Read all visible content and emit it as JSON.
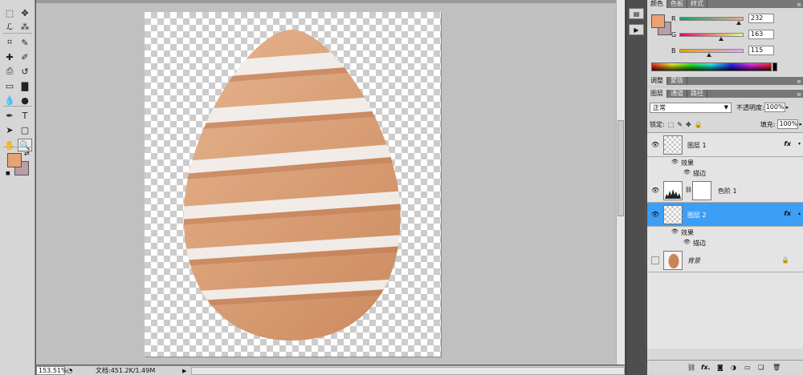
{
  "tools": {
    "icons": [
      "marquee-icon",
      "move-icon",
      "lasso-icon",
      "magic-wand-icon",
      "crop-icon",
      "eyedropper-icon",
      "healing-brush-icon",
      "brush-icon",
      "clone-stamp-icon",
      "history-brush-icon",
      "eraser-icon",
      "gradient-icon",
      "blur-icon",
      "dodge-icon",
      "pen-icon",
      "type-icon",
      "path-selection-icon",
      "shape-icon",
      "hand-icon",
      "zoom-icon"
    ],
    "glyphs": [
      "⬚",
      "✥",
      "ℒ",
      "⁂",
      "⌗",
      "✎",
      "✚",
      "✐",
      "⎙",
      "↺",
      "▭",
      "▇",
      "💧",
      "●",
      "✒",
      "T",
      "➤",
      "▢",
      "✋",
      "🔍"
    ],
    "foreground_color": "#e8a373",
    "background_color": "#b79ea7"
  },
  "canvas": {
    "egg_color": "#d99a73",
    "egg_light": "#e9b994",
    "egg_shadow": "#bf7a52"
  },
  "statusbar": {
    "zoom": "153.51%",
    "doc_info": "文档:451.2K/1.49M",
    "arrow": "▶"
  },
  "color_panel": {
    "tabs": [
      "颜色",
      "色板",
      "样式"
    ],
    "r_label": "R",
    "g_label": "G",
    "b_label": "B",
    "r": 232,
    "g": 163,
    "b": 115,
    "r_value": "232",
    "g_value": "163",
    "b_value": "115"
  },
  "adjustments_panel": {
    "tabs": [
      "调整",
      "蒙版"
    ]
  },
  "layers_panel": {
    "tabs": [
      "图层",
      "通道",
      "路径"
    ],
    "blend_mode": "正常",
    "opacity_label": "不透明度:",
    "opacity_value": "100%",
    "lock_label": "锁定:",
    "fill_label": "填充:",
    "fill_value": "100%",
    "layers": [
      {
        "name": "图层 1",
        "fx": "fx",
        "effects_label": "效果",
        "effect_name": "描边"
      },
      {
        "name": "色阶 1"
      },
      {
        "name": "图层 2",
        "fx": "fx",
        "effects_label": "效果",
        "effect_name": "描边"
      },
      {
        "name": "背景"
      }
    ]
  }
}
